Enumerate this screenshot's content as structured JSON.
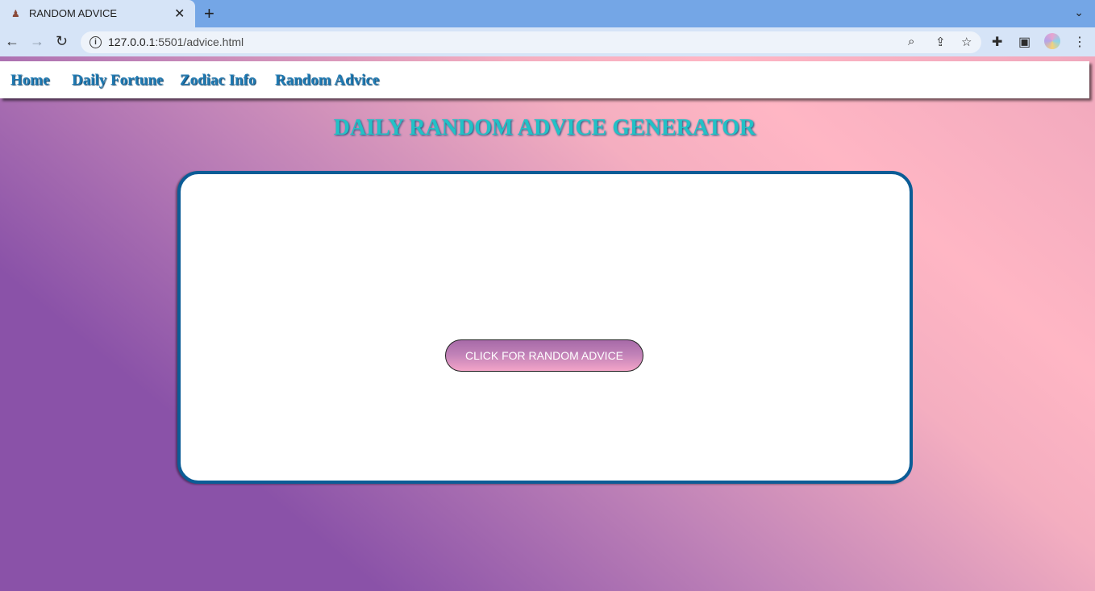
{
  "browser": {
    "tab": {
      "title": "RANDOM ADVICE",
      "favicon": "person-favicon"
    },
    "url_host": "127.0.0.1",
    "url_path": ":5501/advice.html",
    "colors": {
      "tabbar": "#74a6e6",
      "toolbar": "#d6e4f7"
    }
  },
  "nav": {
    "links": [
      "Home",
      "Daily Fortune",
      "Zodiac Info",
      "Random Advice"
    ]
  },
  "main": {
    "title": "DAILY RANDOM ADVICE GENERATOR",
    "advice_text": "",
    "button_label": "CLICK FOR RANDOM ADVICE"
  },
  "colors": {
    "nav_link": "#1e7ab3",
    "title": "#22c1c6",
    "card_border": "#0b5c96",
    "gradient_start": "#8a52a8",
    "gradient_end": "#ffb6c4"
  }
}
